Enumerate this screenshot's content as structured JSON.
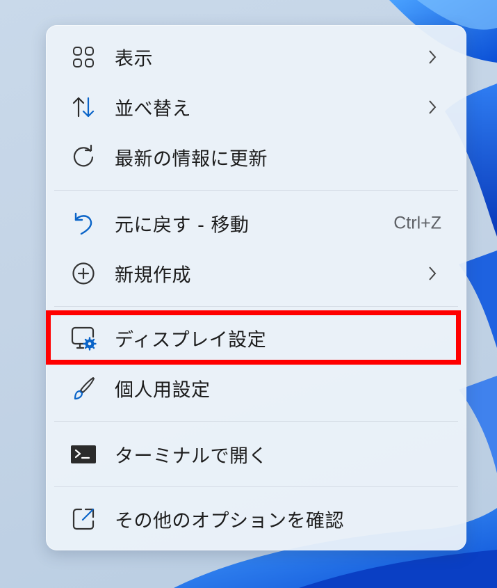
{
  "menu": {
    "items": [
      {
        "label": "表示",
        "icon": "grid-view-icon",
        "submenu": true
      },
      {
        "label": "並べ替え",
        "icon": "sort-arrows-icon",
        "submenu": true
      },
      {
        "label": "最新の情報に更新",
        "icon": "refresh-icon",
        "submenu": false
      },
      {
        "label": "元に戻す - 移動",
        "icon": "undo-icon",
        "shortcut": "Ctrl+Z"
      },
      {
        "label": "新規作成",
        "icon": "add-circle-icon",
        "submenu": true
      },
      {
        "label": "ディスプレイ設定",
        "icon": "display-settings-icon",
        "submenu": false,
        "highlighted": true
      },
      {
        "label": "個人用設定",
        "icon": "paintbrush-icon",
        "submenu": false
      },
      {
        "label": "ターミナルで開く",
        "icon": "terminal-icon",
        "submenu": false
      },
      {
        "label": "その他のオプションを確認",
        "icon": "share-external-icon",
        "submenu": false
      }
    ]
  },
  "colors": {
    "highlight_border": "#ff0000",
    "accent": "#0a64c8",
    "menu_background": "#ecf2f9"
  }
}
